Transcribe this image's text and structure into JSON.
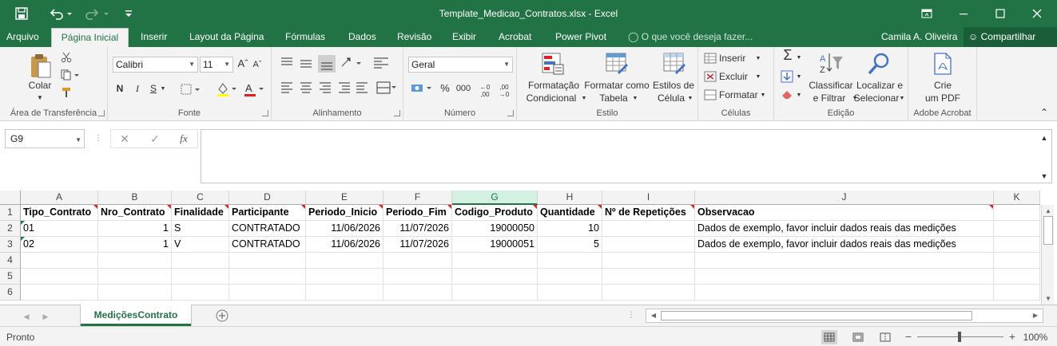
{
  "window": {
    "title": "Template_Medicao_Contratos.xlsx - Excel",
    "controls": [
      "save-icon",
      "undo-icon",
      "redo-icon",
      "customize-qat-icon"
    ]
  },
  "tabs": [
    "Arquivo",
    "Página Inicial",
    "Inserir",
    "Layout da Página",
    "Fórmulas",
    "Dados",
    "Revisão",
    "Exibir",
    "Acrobat",
    "Power Pivot"
  ],
  "active_tab": "Página Inicial",
  "tell_me": "O que você deseja fazer...",
  "user": "Camila A. Oliveira",
  "share": "Compartilhar",
  "ribbon": {
    "clipboard": {
      "label": "Área de Transferência",
      "paste": "Colar"
    },
    "font": {
      "label": "Fonte",
      "name": "Calibri",
      "size": "11",
      "bold": "N",
      "italic": "I",
      "underline": "S"
    },
    "alignment": {
      "label": "Alinhamento"
    },
    "number": {
      "label": "Número",
      "format": "Geral"
    },
    "styles": {
      "label": "Estilo",
      "cond1": "Formatação",
      "cond2": "Condicional",
      "table1": "Formatar como",
      "table2": "Tabela",
      "cell1": "Estilos de",
      "cell2": "Célula"
    },
    "cells": {
      "label": "Células",
      "insert": "Inserir",
      "delete": "Excluir",
      "format": "Formatar"
    },
    "editing": {
      "label": "Edição",
      "sort1": "Classificar",
      "sort2": "e Filtrar",
      "find1": "Localizar e",
      "find2": "Selecionar"
    },
    "acrobat": {
      "label": "Adobe Acrobat",
      "pdf1": "Crie",
      "pdf2": "um PDF"
    }
  },
  "formula_bar": {
    "name_box": "G9",
    "fx": "fx",
    "value": ""
  },
  "columns": [
    "A",
    "B",
    "C",
    "D",
    "E",
    "F",
    "G",
    "H",
    "I",
    "J",
    "K"
  ],
  "selected_column": "G",
  "rows": [
    [
      "Tipo_Contrato",
      "Nro_Contrato",
      "Finalidade",
      "Participante",
      "Periodo_Inicio",
      "Periodo_Fim",
      "Codigo_Produto",
      "Quantidade",
      "Nº de Repetições",
      "Observacao",
      ""
    ],
    [
      "01",
      "1",
      "S",
      "CONTRATADO",
      "11/06/2026",
      "11/07/2026",
      "19000050",
      "10",
      "",
      "Dados de exemplo, favor incluir dados reais das medições",
      ""
    ],
    [
      "02",
      "1",
      "V",
      "CONTRATADO",
      "11/06/2026",
      "11/07/2026",
      "19000051",
      "5",
      "",
      "Dados de exemplo, favor incluir dados reais das medições",
      ""
    ],
    [
      "",
      "",
      "",
      "",
      "",
      "",
      "",
      "",
      "",
      "",
      ""
    ],
    [
      "",
      "",
      "",
      "",
      "",
      "",
      "",
      "",
      "",
      "",
      ""
    ],
    [
      "",
      "",
      "",
      "",
      "",
      "",
      "",
      "",
      "",
      "",
      ""
    ]
  ],
  "row_numbers": [
    "1",
    "2",
    "3",
    "4",
    "5",
    "6"
  ],
  "sheet_tab": "MediçõesContrato",
  "status": {
    "ready": "Pronto",
    "zoom": "100%"
  },
  "colors": {
    "accent": "#217346",
    "note": "#e02020"
  }
}
